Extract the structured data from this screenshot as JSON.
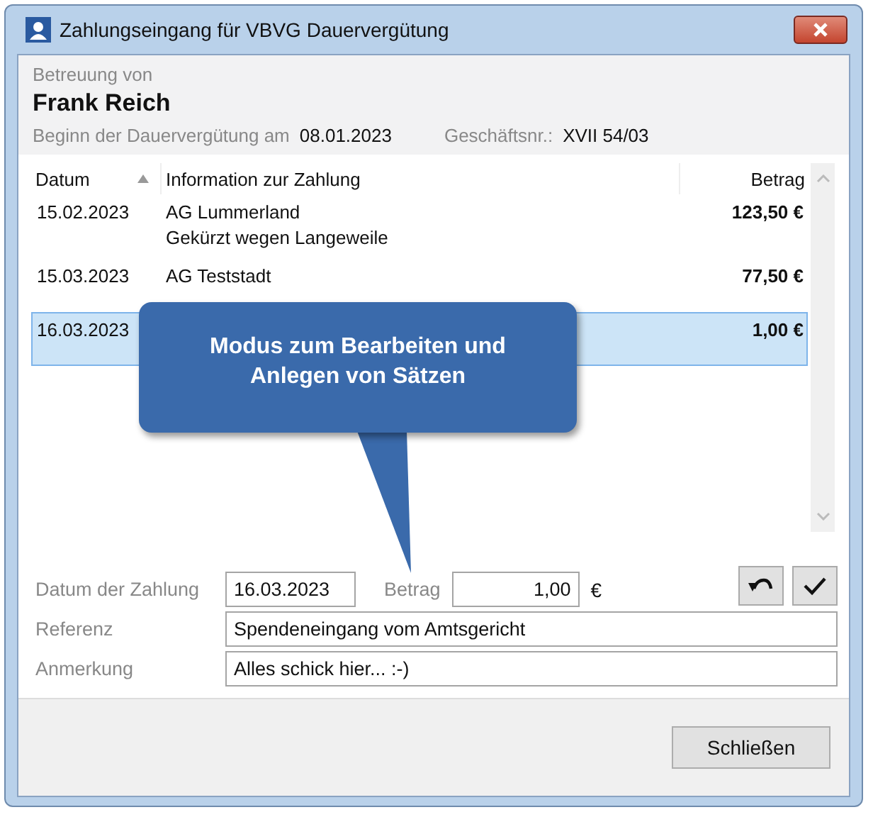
{
  "window": {
    "title": "Zahlungseingang für VBVG Dauervergütung"
  },
  "header": {
    "caption": "Betreuung von",
    "name": "Frank Reich",
    "start_label": "Beginn der Dauervergütung am",
    "start_value": "08.01.2023",
    "case_label": "Geschäftsnr.:",
    "case_value": "XVII 54/03"
  },
  "table": {
    "columns": [
      {
        "label": "Datum",
        "sorted": true
      },
      {
        "label": "Information zur Zahlung",
        "sorted": false
      },
      {
        "label": "Betrag",
        "sorted": false
      }
    ],
    "rows": [
      {
        "date": "15.02.2023",
        "info": [
          "AG Lummerland",
          "Gekürzt wegen Langeweile"
        ],
        "amount": "123,50 €",
        "selected": false
      },
      {
        "date": "15.03.2023",
        "info": [
          "AG Teststadt"
        ],
        "amount": "77,50 €",
        "selected": false
      },
      {
        "date": "16.03.2023",
        "info": [],
        "amount": "1,00 €",
        "selected": true
      }
    ]
  },
  "callout": {
    "text": "Modus zum Bearbeiten und Anlegen von Sätzen"
  },
  "form": {
    "date_label": "Datum der Zahlung",
    "date_value": "16.03.2023",
    "amount_label": "Betrag",
    "amount_value": "1,00",
    "currency": "€",
    "reference_label": "Referenz",
    "reference_value": "Spendeneingang vom Amtsgericht",
    "note_label": "Anmerkung",
    "note_value": "Alles schick hier... :-)"
  },
  "buttons": {
    "close": "Schließen"
  }
}
